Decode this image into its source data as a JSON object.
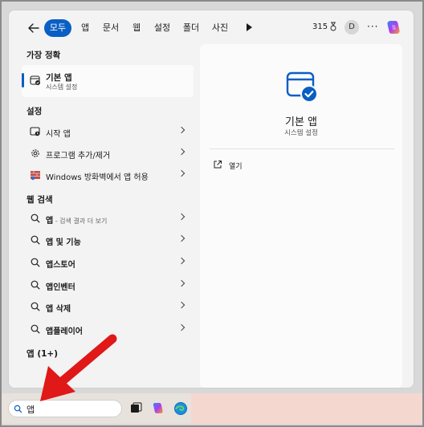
{
  "filter_tabs": [
    {
      "label": "모두",
      "active": true
    },
    {
      "label": "앱",
      "active": false
    },
    {
      "label": "문서",
      "active": false
    },
    {
      "label": "웹",
      "active": false
    },
    {
      "label": "설정",
      "active": false
    },
    {
      "label": "폴더",
      "active": false
    },
    {
      "label": "사진",
      "active": false
    }
  ],
  "header": {
    "points": "315",
    "avatar_initial": "D",
    "more": "···"
  },
  "best_match": {
    "section_label": "가장 정확",
    "title": "기본 앱",
    "subtitle": "시스템 설정"
  },
  "settings": {
    "section_label": "설정",
    "items": [
      {
        "label": "시작 앱",
        "icon": "startup-apps-icon"
      },
      {
        "label": "프로그램 추가/제거",
        "icon": "gear-icon"
      },
      {
        "label": "Windows 방화벽에서 앱 허용",
        "icon": "firewall-icon"
      }
    ]
  },
  "web_search": {
    "section_label": "웹 검색",
    "items": [
      {
        "prefix": "앱",
        "suffix": " - 검색 결과 더 보기"
      },
      {
        "prefix": "앱 및 기능",
        "suffix": ""
      },
      {
        "prefix": "앱스토어",
        "suffix": ""
      },
      {
        "prefix": "앱인벤터",
        "suffix": ""
      },
      {
        "prefix": "앱 삭제",
        "suffix": ""
      },
      {
        "prefix": "앱플레이어",
        "suffix": ""
      }
    ]
  },
  "apps_section": {
    "label": "앱 (1+)"
  },
  "preview": {
    "title": "기본 앱",
    "subtitle": "시스템 설정",
    "open_label": "열기"
  },
  "taskbar": {
    "search_value": "앱"
  },
  "colors": {
    "accent": "#0a5fc4",
    "arrow": "#e01818"
  }
}
